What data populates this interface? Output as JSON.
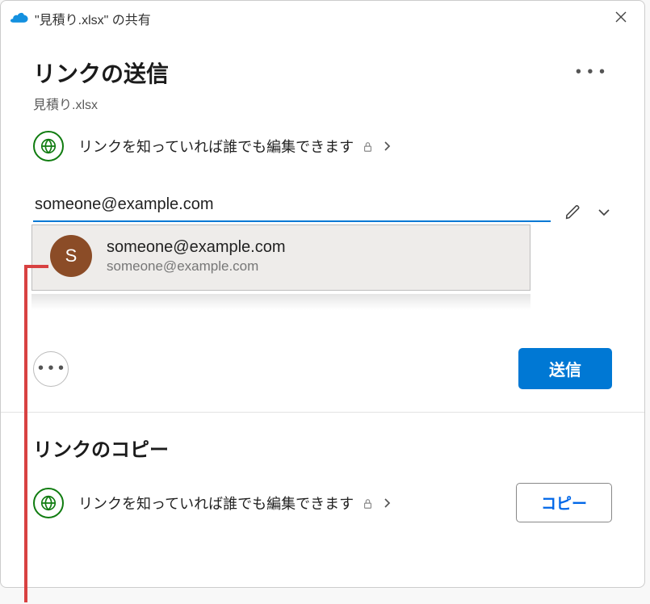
{
  "titlebar": {
    "full_title": "\"見積り.xlsx\" の共有"
  },
  "header": {
    "title": "リンクの送信",
    "filename": "見積り.xlsx"
  },
  "permission": {
    "text": "リンクを知っていれば誰でも編集できます"
  },
  "input": {
    "value": "someone@example.com"
  },
  "suggestion": {
    "initial": "S",
    "primary": "someone@example.com",
    "secondary": "someone@example.com"
  },
  "actions": {
    "send_label": "送信"
  },
  "copy": {
    "title": "リンクのコピー",
    "perm_text": "リンクを知っていれば誰でも編集できます",
    "button_label": "コピー"
  }
}
